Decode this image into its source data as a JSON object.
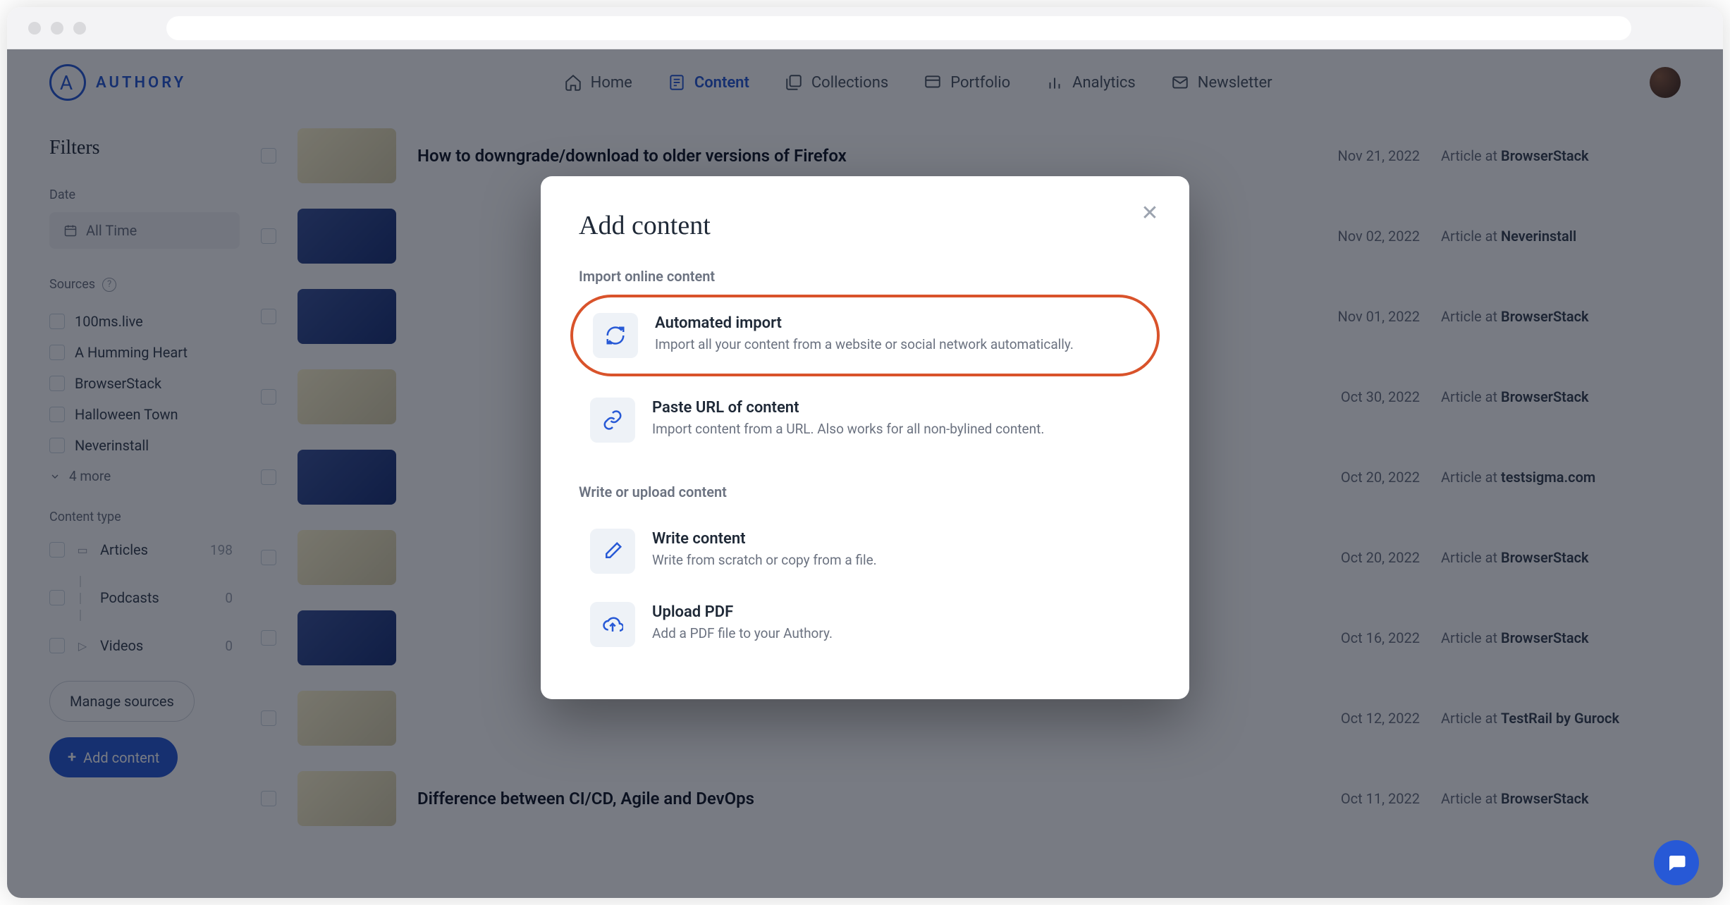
{
  "brand": "AUTHORY",
  "nav": {
    "home": "Home",
    "content": "Content",
    "collections": "Collections",
    "portfolio": "Portfolio",
    "analytics": "Analytics",
    "newsletter": "Newsletter"
  },
  "sidebar": {
    "filters_title": "Filters",
    "date_label": "Date",
    "date_value": "All Time",
    "sources_label": "Sources",
    "sources": [
      "100ms.live",
      "A Humming Heart",
      "BrowserStack",
      "Halloween Town",
      "Neverinstall"
    ],
    "more": "4 more",
    "content_type_label": "Content type",
    "ct": [
      {
        "name": "Articles",
        "count": "198"
      },
      {
        "name": "Podcasts",
        "count": "0"
      },
      {
        "name": "Videos",
        "count": "0"
      }
    ],
    "manage": "Manage sources",
    "add": "Add content"
  },
  "rows": [
    {
      "title": "How to downgrade/download to older versions of Firefox",
      "date": "Nov 21, 2022",
      "source": "BrowserStack",
      "thumb": "light"
    },
    {
      "title": "",
      "date": "Nov 02, 2022",
      "source": "Neverinstall",
      "thumb": "dark"
    },
    {
      "title": "",
      "date": "Nov 01, 2022",
      "source": "BrowserStack",
      "thumb": "dark"
    },
    {
      "title": "",
      "date": "Oct 30, 2022",
      "source": "BrowserStack",
      "thumb": "light"
    },
    {
      "title": "",
      "date": "Oct 20, 2022",
      "source": "testsigma.com",
      "thumb": "dark"
    },
    {
      "title": "",
      "date": "Oct 20, 2022",
      "source": "BrowserStack",
      "thumb": "light"
    },
    {
      "title": "",
      "date": "Oct 16, 2022",
      "source": "BrowserStack",
      "thumb": "dark"
    },
    {
      "title": "",
      "date": "Oct 12, 2022",
      "source": "TestRail by Gurock",
      "thumb": "light"
    },
    {
      "title": "Difference between CI/CD, Agile and DevOps",
      "date": "Oct 11, 2022",
      "source": "BrowserStack",
      "thumb": "light"
    }
  ],
  "article_prefix": "Article at ",
  "modal": {
    "title": "Add content",
    "import_section": "Import online content",
    "write_section": "Write or upload content",
    "options": {
      "automated": {
        "title": "Automated import",
        "desc": "Import all your content from a website or social network automatically."
      },
      "paste": {
        "title": "Paste URL of content",
        "desc": "Import content from a URL. Also works for all non-bylined content."
      },
      "write": {
        "title": "Write content",
        "desc": "Write from scratch or copy from a file."
      },
      "upload": {
        "title": "Upload PDF",
        "desc": "Add a PDF file to your Authory."
      }
    }
  }
}
